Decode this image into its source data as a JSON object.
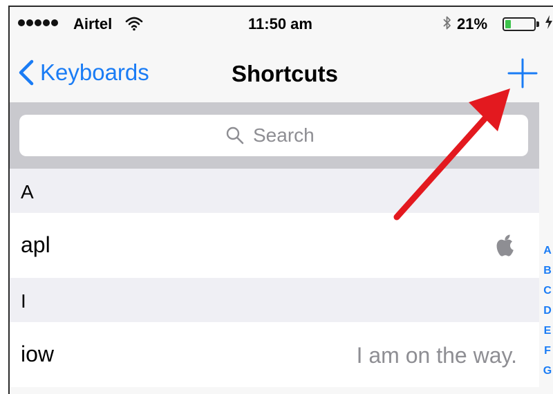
{
  "status_bar": {
    "carrier": "Airtel",
    "time": "11:50 am",
    "battery_percent": "21%",
    "battery_level": 0.21,
    "signal_bars": 5,
    "icons": [
      "wifi-icon",
      "bluetooth-icon",
      "charging-icon"
    ]
  },
  "nav": {
    "back_label": "Keyboards",
    "title": "Shortcuts",
    "add_icon": "plus-icon"
  },
  "search": {
    "placeholder": "Search",
    "value": ""
  },
  "sections": [
    {
      "header": "A",
      "rows": [
        {
          "shortcut": "apl",
          "phrase_icon": "apple-logo-icon"
        }
      ]
    },
    {
      "header": "I",
      "rows": [
        {
          "shortcut": "iow",
          "phrase": "I am on the way."
        }
      ]
    }
  ],
  "index": [
    "A",
    "B",
    "C",
    "D",
    "E",
    "F",
    "G"
  ],
  "colors": {
    "accent": "#1a7cf5",
    "annotation": "#e3191f",
    "search_bg": "#c9c9ce",
    "section_bg": "#efeff4",
    "secondary_text": "#8e8e93"
  }
}
